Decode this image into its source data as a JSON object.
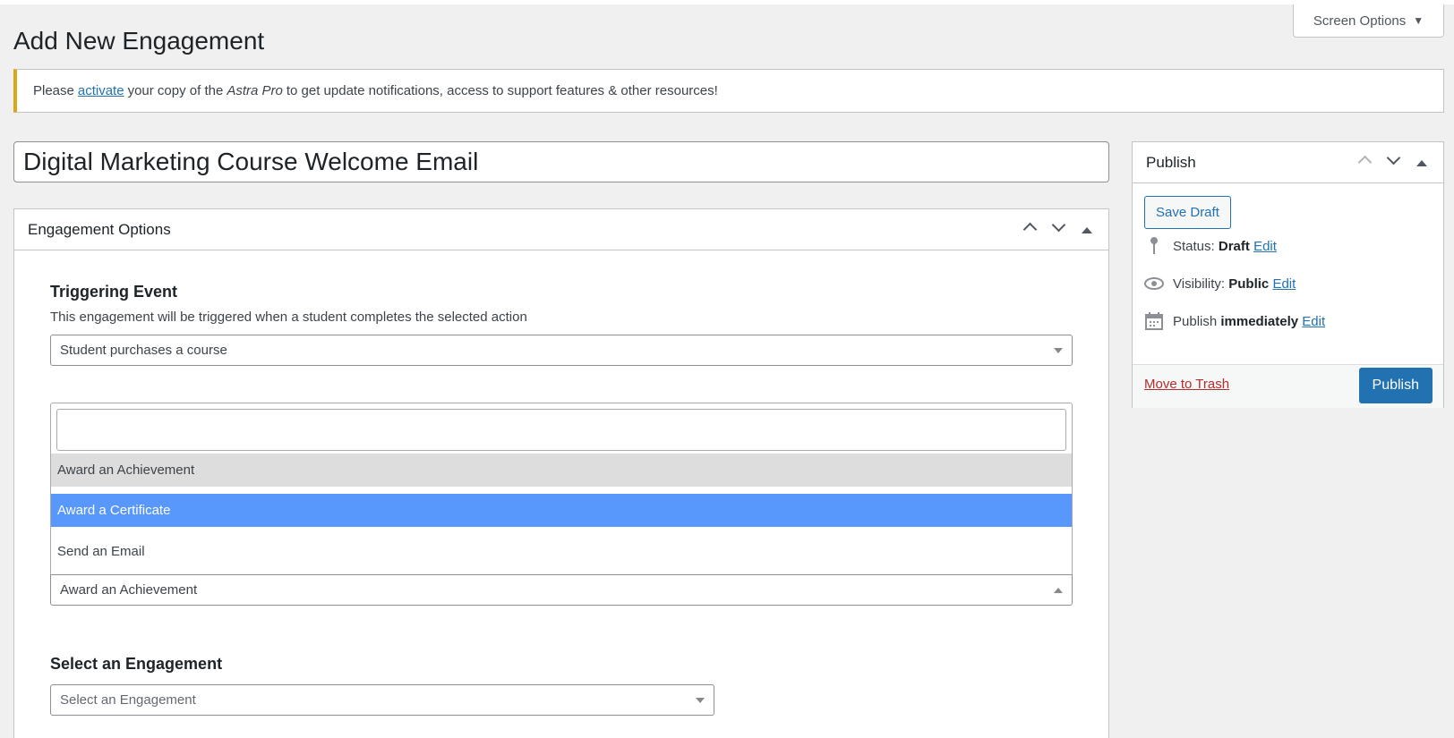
{
  "header": {
    "screen_options_label": "Screen Options",
    "page_title": "Add New Engagement"
  },
  "notice": {
    "before": "Please",
    "link": "activate",
    "middle": "your copy of the",
    "product": "Astra Pro",
    "after": "to get update notifications, access to support features & other resources!"
  },
  "post": {
    "title": "Digital Marketing Course Welcome Email"
  },
  "engagement_options": {
    "heading": "Engagement Options",
    "triggering_event": {
      "label": "Triggering Event",
      "description": "This engagement will be triggered when a student completes the selected action",
      "selected": "Student purchases a course"
    },
    "engagement_type": {
      "search_value": "",
      "options": [
        "Award an Achievement",
        "Award a Certificate",
        "Send an Email"
      ],
      "hovered_option": "Award an Achievement",
      "highlighted_option": "Award a Certificate",
      "selected": "Award an Achievement"
    },
    "select_engagement": {
      "label": "Select an Engagement",
      "placeholder": "Select an Engagement"
    }
  },
  "publish": {
    "heading": "Publish",
    "save_draft_label": "Save Draft",
    "status_label": "Status:",
    "status_value": "Draft",
    "visibility_label": "Visibility:",
    "visibility_value": "Public",
    "publish_label": "Publish",
    "publish_value": "immediately",
    "edit_label": "Edit",
    "trash_label": "Move to Trash",
    "publish_button": "Publish"
  },
  "colors": {
    "accent": "#2271b1",
    "highlight": "#5897fb",
    "notice_border": "#dba617",
    "trash": "#b32d2e"
  }
}
